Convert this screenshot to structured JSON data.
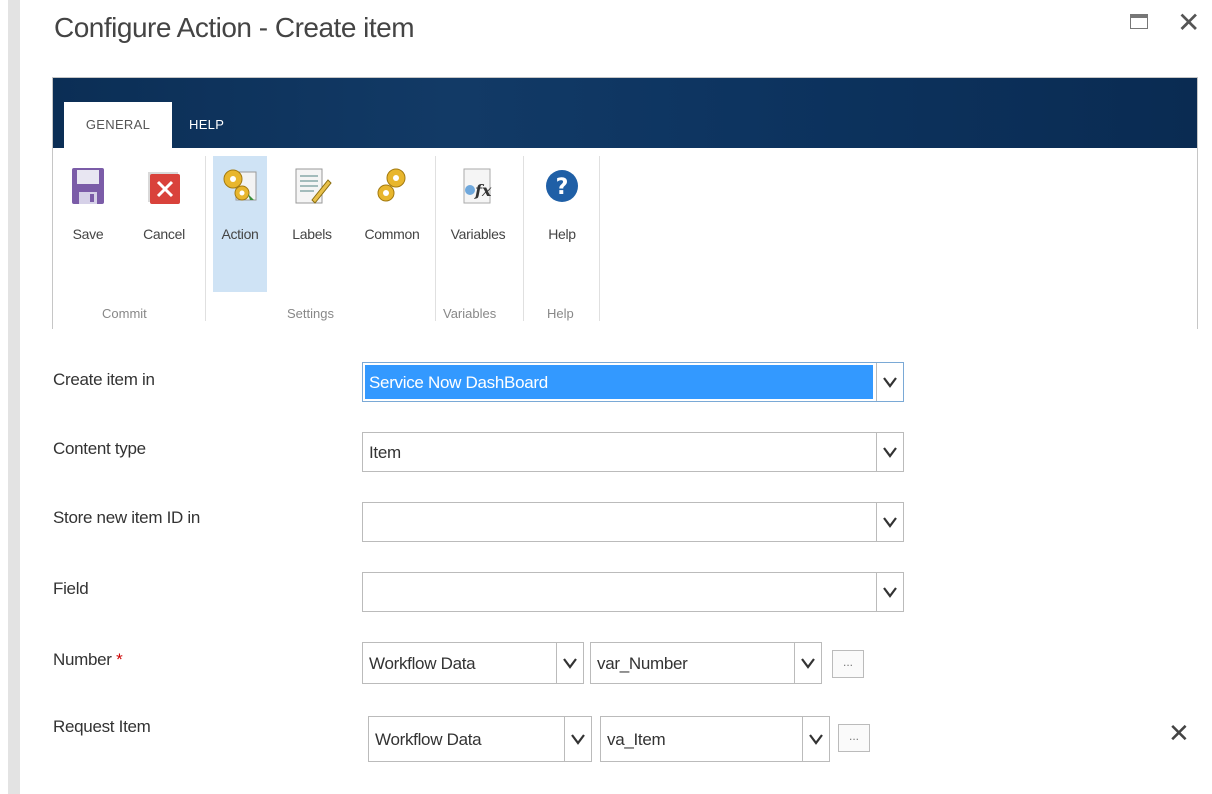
{
  "dialog": {
    "title": "Configure Action - Create item"
  },
  "tabs": [
    {
      "label": "GENERAL"
    },
    {
      "label": "HELP"
    }
  ],
  "ribbon": {
    "tools": [
      {
        "label": "Save"
      },
      {
        "label": "Cancel"
      },
      {
        "label": "Action"
      },
      {
        "label": "Labels"
      },
      {
        "label": "Common"
      },
      {
        "label": "Variables"
      },
      {
        "label": "Help"
      }
    ],
    "groups": [
      {
        "label": "Commit"
      },
      {
        "label": "Settings"
      },
      {
        "label": "Variables"
      },
      {
        "label": "Help"
      }
    ]
  },
  "form": {
    "create_item_in": {
      "label": "Create item in",
      "value": "Service Now DashBoard"
    },
    "content_type": {
      "label": "Content type",
      "value": "Item"
    },
    "store_id": {
      "label": "Store new item ID in",
      "value": ""
    },
    "field": {
      "label": "Field",
      "value": ""
    },
    "number": {
      "label": "Number",
      "required_mark": "*",
      "source": "Workflow Data",
      "variable": "var_Number",
      "ellipsis": "..."
    },
    "request_item": {
      "label": "Request Item",
      "source": "Workflow Data",
      "variable": "va_Item",
      "ellipsis": "..."
    }
  },
  "colors": {
    "ribbon_header": "#0b2e55",
    "selected_highlight": "#3399ff",
    "active_tool": "#cfe3f5",
    "required": "#cc0000"
  }
}
